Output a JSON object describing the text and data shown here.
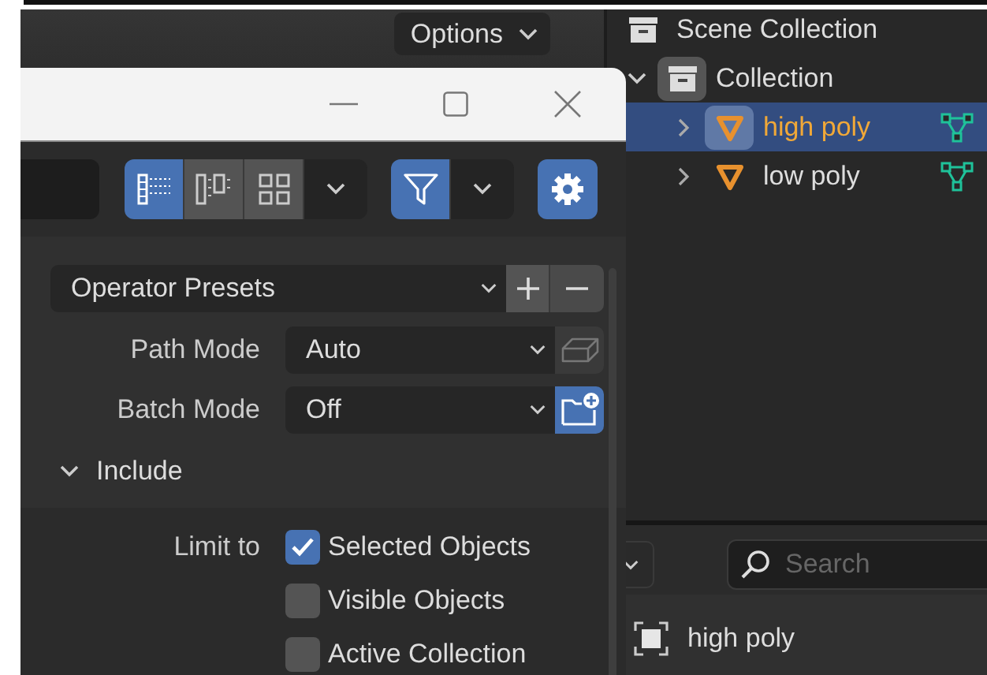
{
  "header": {
    "options_label": "Options"
  },
  "outliner": {
    "items": [
      {
        "label": "Scene Collection",
        "kind": "scene-collection",
        "selected": false,
        "children": [
          {
            "label": "Collection",
            "kind": "collection",
            "selected": false,
            "expanded": true,
            "children": [
              {
                "label": "high poly",
                "kind": "mesh-object",
                "selected": true,
                "expanded": false
              },
              {
                "label": "low poly",
                "kind": "mesh-object",
                "selected": false,
                "expanded": false
              }
            ]
          }
        ]
      }
    ]
  },
  "dialog": {
    "view_modes": [
      {
        "kind": "vertical-list",
        "selected": true
      },
      {
        "kind": "horizontal-list",
        "selected": false
      },
      {
        "kind": "thumbnails",
        "selected": false
      }
    ],
    "filter_on": true,
    "settings_on": true,
    "presets_label": "Operator Presets",
    "fields": [
      {
        "label": "Path Mode",
        "value": "Auto",
        "kind": "path",
        "on": false
      },
      {
        "label": "Batch Mode",
        "value": "Off",
        "kind": "batch",
        "on": true
      }
    ],
    "include": {
      "label": "Include",
      "expanded": true,
      "limit_label": "Limit to",
      "options": [
        {
          "label": "Selected Objects",
          "checked": true
        },
        {
          "label": "Visible Objects",
          "checked": false
        },
        {
          "label": "Active Collection",
          "checked": false
        }
      ]
    }
  },
  "properties": {
    "search_placeholder": "Search",
    "object_name": "high poly"
  }
}
